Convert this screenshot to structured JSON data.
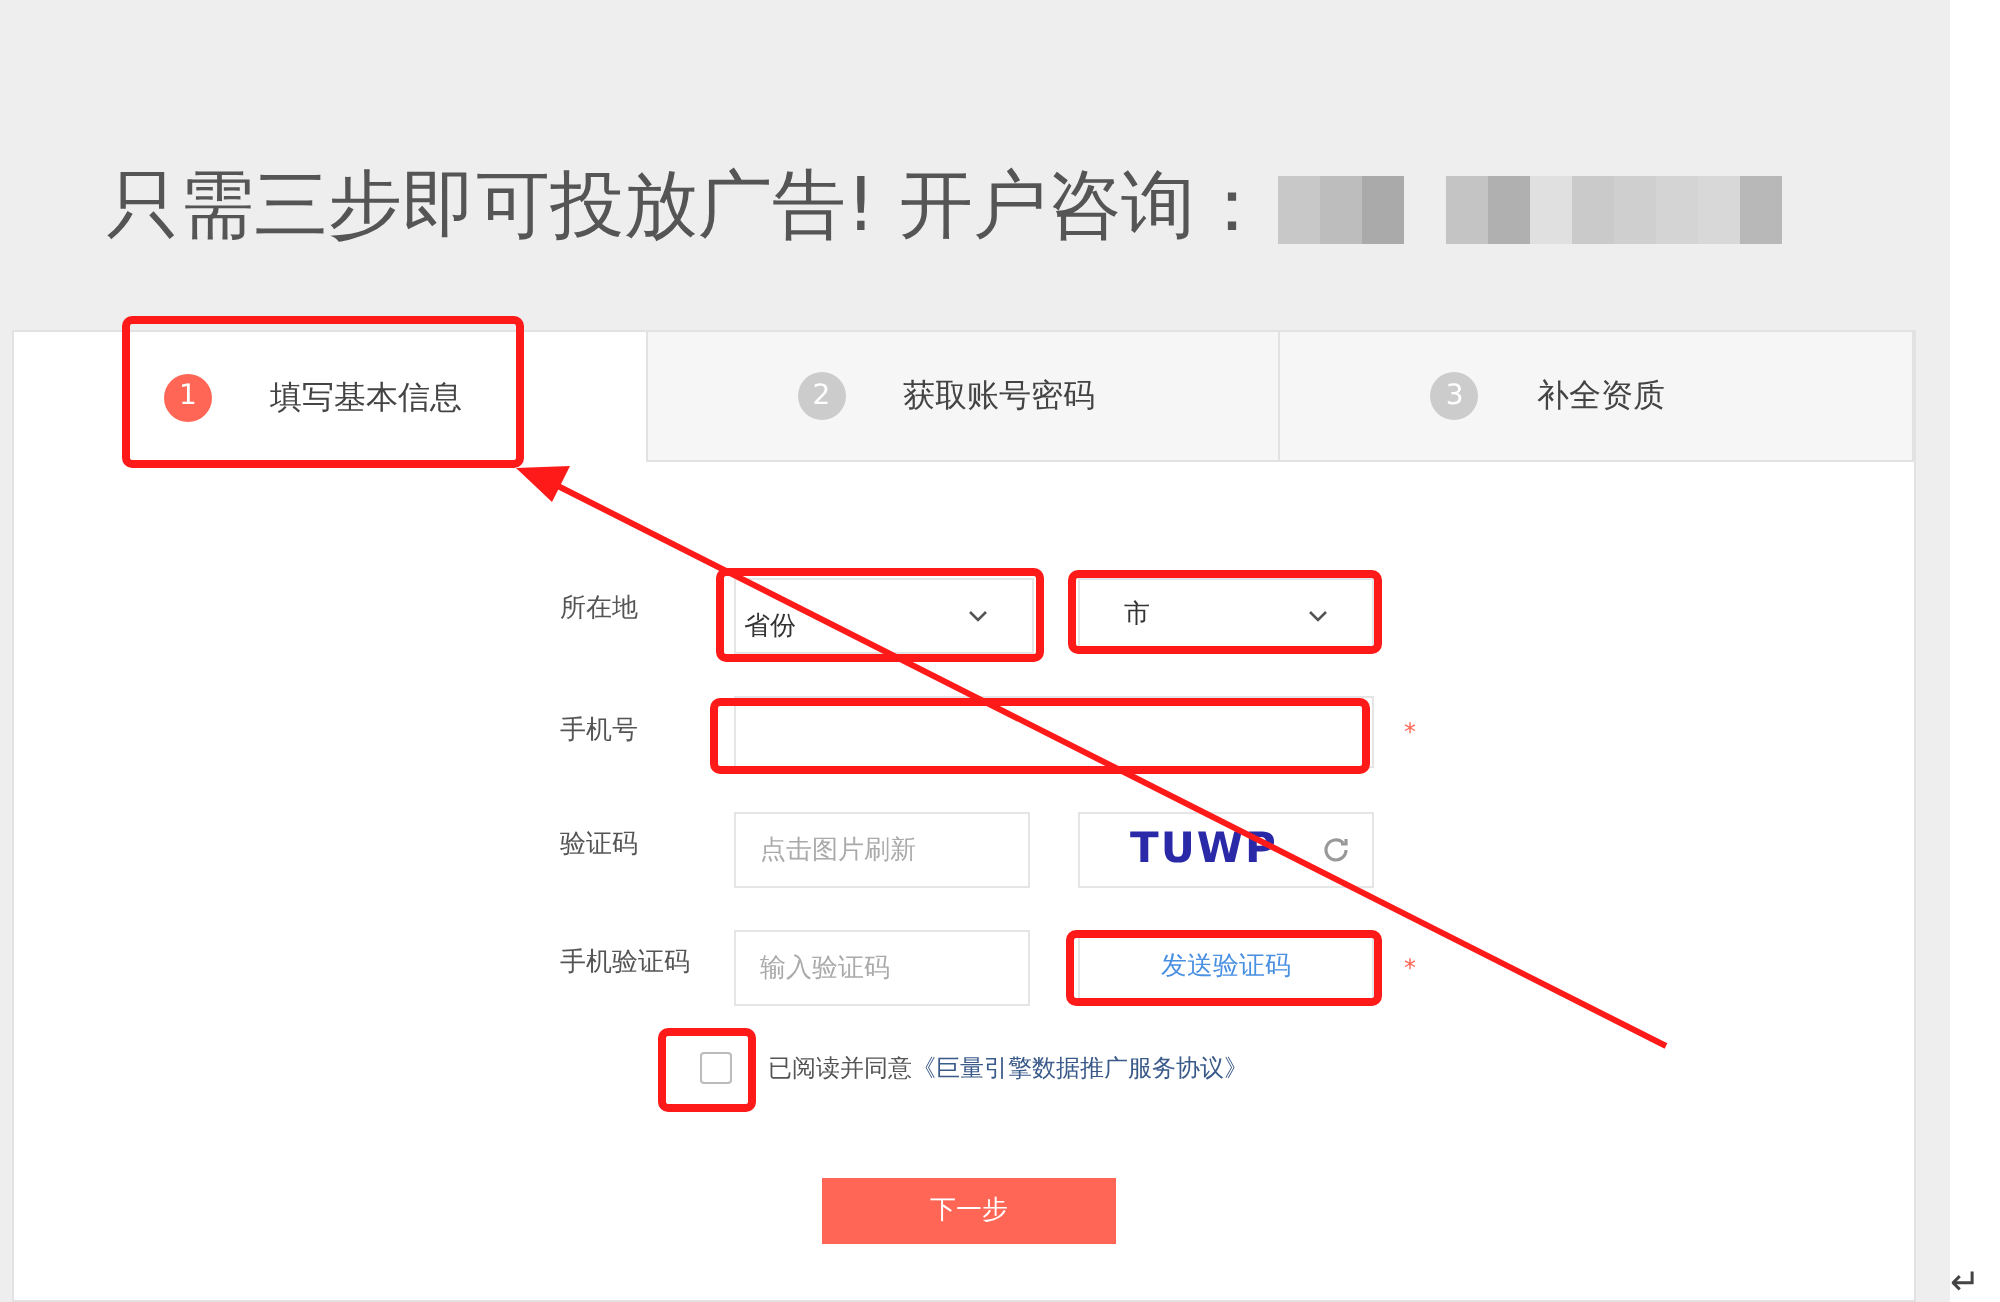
{
  "headline": {
    "text": "只需三步即可投放广告! 开户咨询："
  },
  "steps": [
    {
      "number": "1",
      "label": "填写基本信息",
      "selected": true
    },
    {
      "number": "2",
      "label": "获取账号密码",
      "selected": false
    },
    {
      "number": "3",
      "label": "补全资质",
      "selected": false
    }
  ],
  "form": {
    "location": {
      "label": "所在地",
      "province": "省份",
      "city": "市"
    },
    "phone": {
      "label": "手机号",
      "required_mark": "*"
    },
    "captcha": {
      "label": "验证码",
      "placeholder": "点击图片刷新",
      "image_text": "TUWP"
    },
    "sms_code": {
      "label": "手机验证码",
      "placeholder": "输入验证码",
      "send_button": "发送验证码",
      "required_mark": "*"
    },
    "agreement": {
      "checked": false,
      "prefix": "已阅读并同意",
      "link": "《巨量引擎数据推广服务协议》"
    },
    "next_button": "下一步"
  },
  "annotations": [
    {
      "kind": "box"
    },
    {
      "kind": "box"
    },
    {
      "kind": "box"
    },
    {
      "kind": "box"
    },
    {
      "kind": "box"
    },
    {
      "kind": "box"
    },
    {
      "kind": "arrow"
    }
  ],
  "return_mark": "↵"
}
